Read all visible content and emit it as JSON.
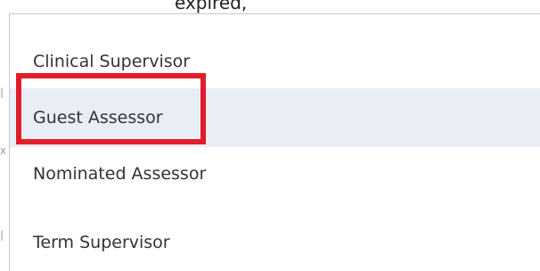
{
  "background_text": "expired,",
  "dropdown": {
    "options": [
      {
        "label": "Clinical Supervisor",
        "highlighted": false
      },
      {
        "label": "Guest Assessor",
        "highlighted": true
      },
      {
        "label": "Nominated Assessor",
        "highlighted": false
      },
      {
        "label": "Term Supervisor",
        "highlighted": false
      }
    ]
  },
  "annotation": {
    "color": "#e21d2a",
    "target": "Guest Assessor"
  },
  "colors": {
    "hover_background": "#e8edf6",
    "text": "#333333"
  }
}
